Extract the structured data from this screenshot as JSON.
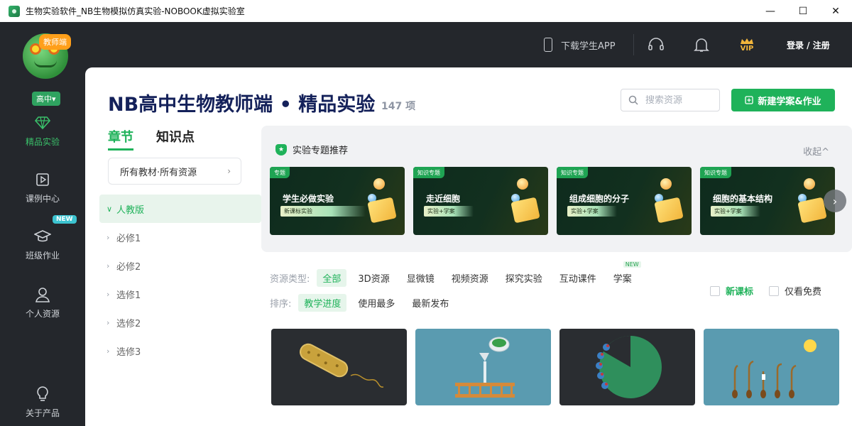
{
  "window": {
    "title": "生物实验软件_NB生物模拟仿真实验-NOBOOK虚拟实验室",
    "controls": [
      "—",
      "☐",
      "✕"
    ]
  },
  "header": {
    "download_app": "下载学生APP",
    "login": "登录 / 注册",
    "vip_label": "VIP"
  },
  "sidebar": {
    "role_badge": "教师端",
    "grade": "高中▾",
    "items": [
      {
        "label": "精品实验",
        "icon": "diamond-icon",
        "active": true
      },
      {
        "label": "课例中心",
        "icon": "play-square-icon"
      },
      {
        "label": "班级作业",
        "icon": "graduation-cap-icon",
        "badge": "NEW"
      },
      {
        "label": "个人资源",
        "icon": "user-icon"
      },
      {
        "label": "关于产品",
        "icon": "lightbulb-icon"
      }
    ]
  },
  "main": {
    "title": "NB高中生物教师端 • 精品实验",
    "count": "147 项",
    "search_placeholder": "搜索资源",
    "create_button": "新建学案&作业",
    "tabs": [
      "章节",
      "知识点"
    ],
    "material_filter": "所有教材·所有资源",
    "tree": [
      {
        "label": "人教版",
        "expanded": true
      },
      {
        "label": "必修1"
      },
      {
        "label": "必修2"
      },
      {
        "label": "选修1"
      },
      {
        "label": "选修2"
      },
      {
        "label": "选修3"
      }
    ],
    "featured": {
      "title": "实验专题推荐",
      "collapse": "收起^",
      "cards": [
        {
          "tag": "专题",
          "title": "学生必做实验",
          "subtitle": "新课标实验"
        },
        {
          "tag": "知识专题",
          "title": "走近细胞",
          "subtitle": "实验+学案"
        },
        {
          "tag": "知识专题",
          "title": "组成细胞的分子",
          "subtitle": "实验+学案"
        },
        {
          "tag": "知识专题",
          "title": "细胞的基本结构",
          "subtitle": "实验+学案"
        }
      ]
    },
    "resource_type_label": "资源类型:",
    "resource_types": [
      "全部",
      "3D资源",
      "显微镜",
      "视频资源",
      "探究实验",
      "互动课件",
      "学案"
    ],
    "resource_type_new": "NEW",
    "sort_label": "排序:",
    "sort_options": [
      "教学进度",
      "使用最多",
      "最新发布"
    ],
    "checkboxes": [
      "新课标",
      "仅看免费"
    ]
  },
  "colors": {
    "accent": "#1fb25a",
    "dark_bg": "#24272c",
    "title": "#14215a"
  }
}
